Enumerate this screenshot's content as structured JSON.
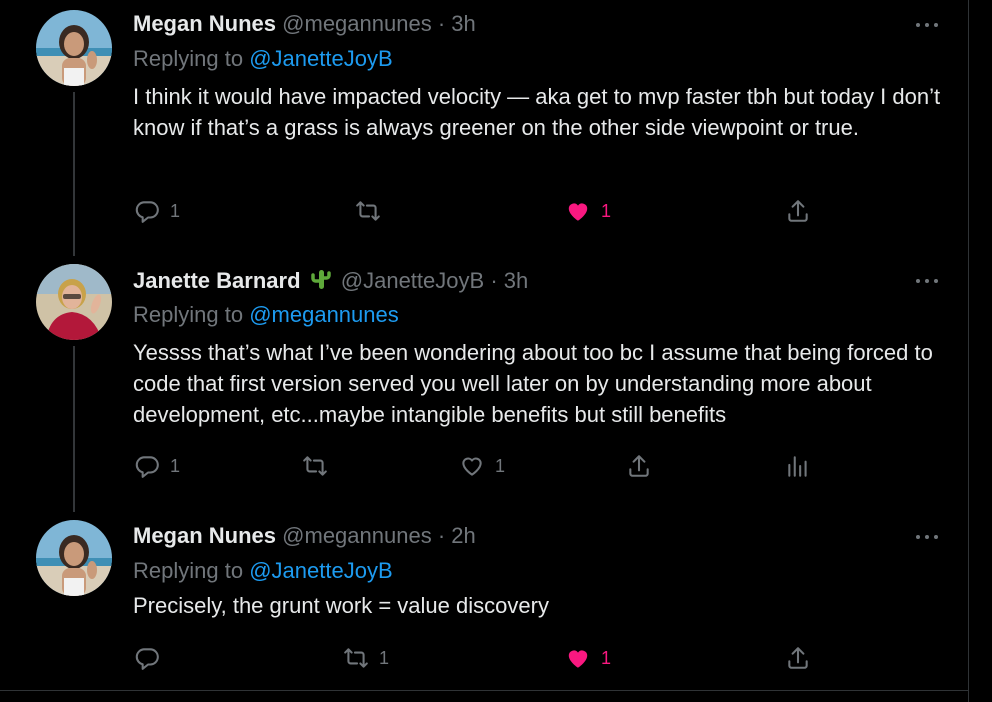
{
  "tweets": [
    {
      "name": "Megan Nunes",
      "handle": "@megannunes",
      "dot": "·",
      "time": "3h",
      "replying_prefix": "Replying to",
      "replying_to": "@JanetteJoyB",
      "text": "I think it would have impacted velocity — aka get to mvp faster tbh but today I don’t know if that’s a grass is always greener on the other side viewpoint or true.",
      "reply_count": "1",
      "retweet_count": "",
      "like_count": "1",
      "liked": true
    },
    {
      "name": "Janette Barnard",
      "name_emoji": "cactus-emoji",
      "handle": "@JanetteJoyB",
      "dot": "·",
      "time": "3h",
      "replying_prefix": "Replying to",
      "replying_to": "@megannunes",
      "text": "Yessss that’s what I’ve been wondering about too bc I assume that being forced to code that first version served you well later on by understanding more about development, etc...maybe intangible benefits but still benefits",
      "reply_count": "1",
      "retweet_count": "",
      "like_count": "1",
      "liked": false
    },
    {
      "name": "Megan Nunes",
      "handle": "@megannunes",
      "dot": "·",
      "time": "2h",
      "replying_prefix": "Replying to",
      "replying_to": "@JanetteJoyB",
      "text": "Precisely, the grunt work = value discovery",
      "reply_count": "",
      "retweet_count": "1",
      "like_count": "1",
      "liked": true
    }
  ],
  "colors": {
    "background": "#000000",
    "text": "#e7e9ea",
    "secondary": "#71767b",
    "link": "#1d9bf0",
    "like": "#f91880"
  },
  "icons": [
    "reply-icon",
    "retweet-icon",
    "like-icon",
    "share-icon",
    "analytics-icon",
    "more-icon",
    "cactus-emoji"
  ]
}
